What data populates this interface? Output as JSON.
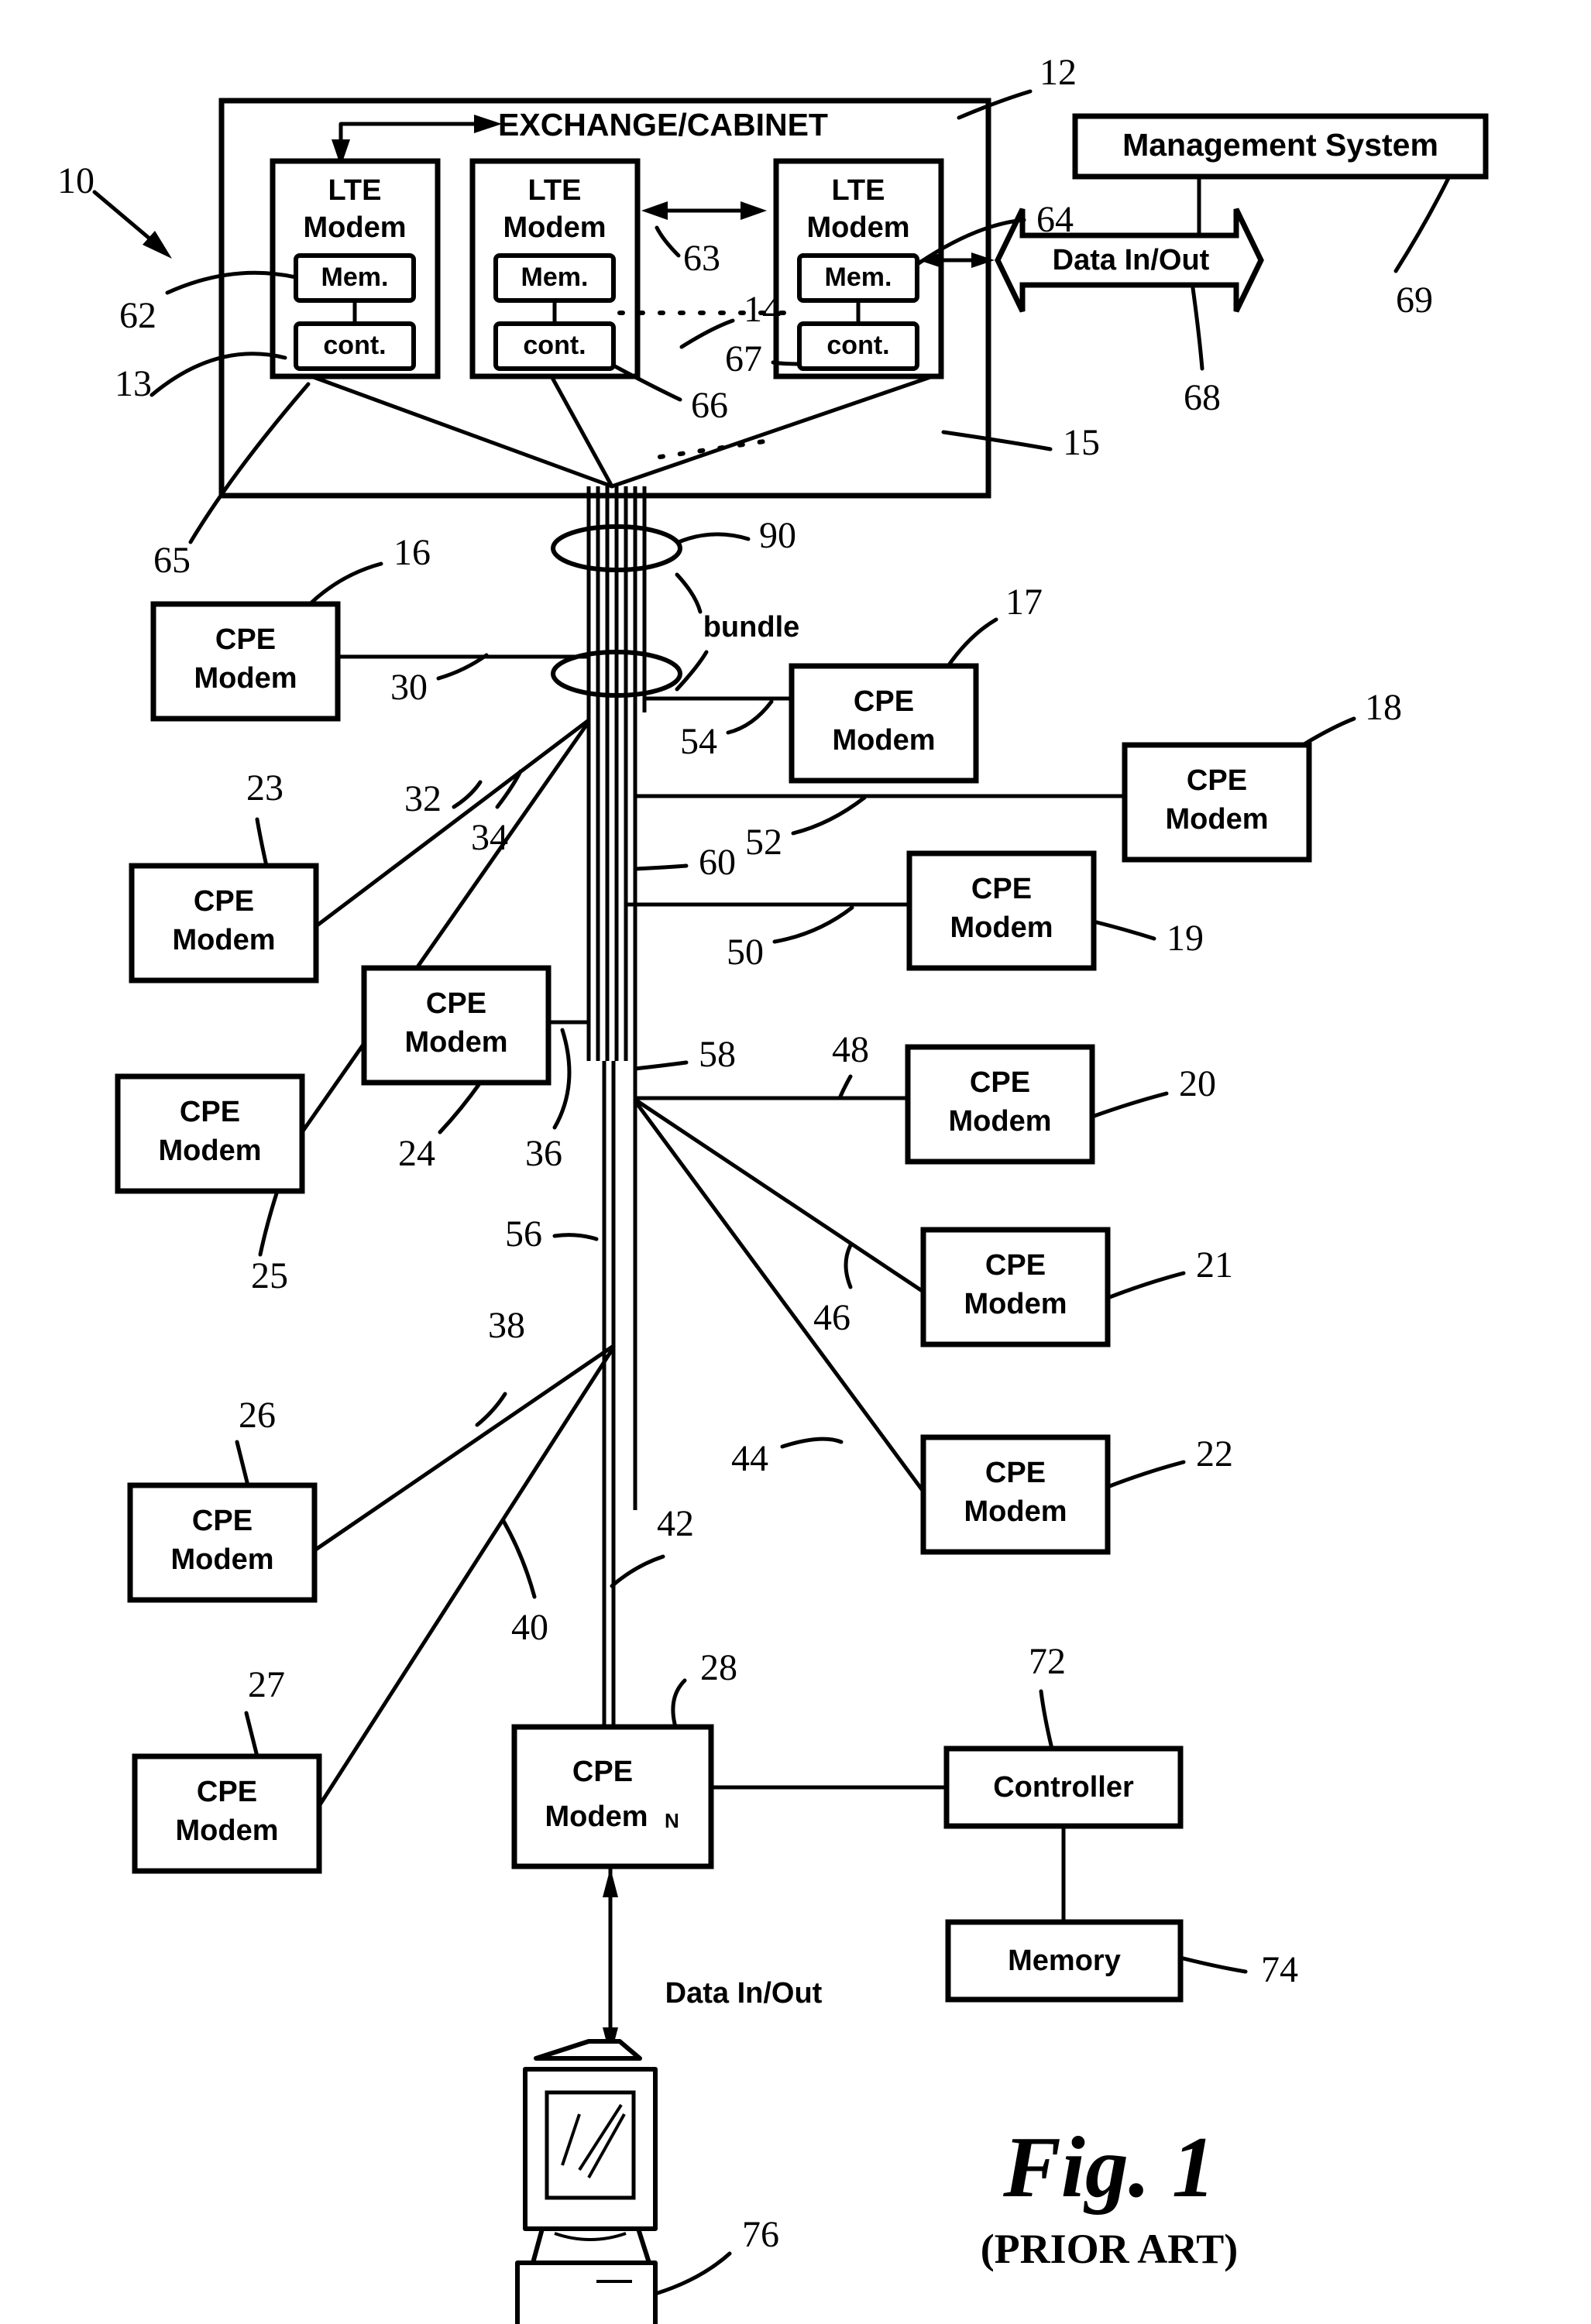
{
  "figure": {
    "title": "Fig. 1",
    "subtitle": "(PRIOR ART)"
  },
  "exchange": {
    "header": "EXCHANGE/CABINET",
    "ref_system": "10",
    "ref_cabinet": "12",
    "ref_line_15": "15",
    "ref_line_14": "14",
    "ref_line_65": "65",
    "ref_line_66": "66",
    "ref_line_67": "67",
    "ref_line_63": "63",
    "lte_modems": [
      {
        "label_line1": "LTE",
        "label_line2": "Modem",
        "memory": "Mem.",
        "controller": "cont.",
        "ref_memory": "62",
        "ref_controller": "13"
      },
      {
        "label_line1": "LTE",
        "label_line2": "Modem",
        "memory": "Mem.",
        "controller": "cont."
      },
      {
        "label_line1": "LTE",
        "label_line2": "Modem",
        "memory": "Mem.",
        "controller": "cont."
      }
    ]
  },
  "management": {
    "label": "Management System",
    "ref": "69",
    "data_arrow_label": "Data In/Out",
    "ref_arrow_left": "64",
    "ref_arrow_bottom": "68"
  },
  "bundle": {
    "ref": "90",
    "label": "bundle"
  },
  "cpe_modems": [
    {
      "label_line1": "CPE",
      "label_line2": "Modem",
      "ref": "16",
      "line_ref": "30"
    },
    {
      "label_line1": "CPE",
      "label_line2": "Modem",
      "ref": "17",
      "line_ref": "54"
    },
    {
      "label_line1": "CPE",
      "label_line2": "Modem",
      "ref": "18",
      "line_ref": "52"
    },
    {
      "label_line1": "CPE",
      "label_line2": "Modem",
      "ref": "19",
      "line_ref": "50"
    },
    {
      "label_line1": "CPE",
      "label_line2": "Modem",
      "ref": "20",
      "line_ref": "48"
    },
    {
      "label_line1": "CPE",
      "label_line2": "Modem",
      "ref": "21",
      "line_ref": "46"
    },
    {
      "label_line1": "CPE",
      "label_line2": "Modem",
      "ref": "22",
      "line_ref": "44"
    },
    {
      "label_line1": "CPE",
      "label_line2": "Modem",
      "ref": "23",
      "line_ref": "32"
    },
    {
      "label_line1": "CPE",
      "label_line2": "Modem",
      "ref": "24",
      "line_ref": "36"
    },
    {
      "label_line1": "CPE",
      "label_line2": "Modem",
      "ref": "25",
      "line_ref": "34"
    },
    {
      "label_line1": "CPE",
      "label_line2": "Modem",
      "ref": "26",
      "line_ref": "38"
    },
    {
      "label_line1": "CPE",
      "label_line2": "Modem",
      "ref": "27",
      "line_ref": "40"
    }
  ],
  "extra_line_refs": {
    "ref_58": "58",
    "ref_56": "56",
    "ref_60": "60",
    "ref_42": "42"
  },
  "cpe_n": {
    "label_line1": "CPE",
    "label_line2": "Modem",
    "subscript": "N",
    "ref": "28",
    "data_label": "Data In/Out"
  },
  "cpe_n_peripherals": {
    "controller_label": "Controller",
    "controller_ref": "72",
    "memory_label": "Memory",
    "memory_ref": "74"
  },
  "computer": {
    "ref": "76"
  },
  "colors": {
    "ink": "#000000",
    "paper": "#ffffff"
  }
}
